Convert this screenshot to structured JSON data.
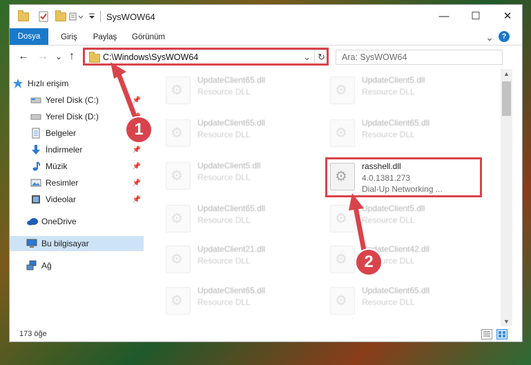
{
  "window": {
    "title": "SysWOW64",
    "minimize": "—",
    "maximize": "☐",
    "close": "✕"
  },
  "ribbon": {
    "tabs": [
      "Dosya",
      "Giriş",
      "Paylaş",
      "Görünüm"
    ],
    "expand": "⌄",
    "help": "?"
  },
  "nav": {
    "back": "←",
    "forward": "→",
    "recent": "⌄",
    "up": "↑",
    "address": "C:\\Windows\\SysWOW64",
    "address_dropdown": "⌄",
    "refresh": "↻",
    "search_placeholder": "Ara: SysWOW64"
  },
  "sidebar": {
    "items": [
      {
        "label": "Hızlı erişim",
        "icon": "star-icon"
      },
      {
        "label": "Yerel Disk (C:)",
        "icon": "drive-icon",
        "pinned": true
      },
      {
        "label": "Yerel Disk (D:)",
        "icon": "drive-icon",
        "pinned": true
      },
      {
        "label": "Belgeler",
        "icon": "documents-icon",
        "pinned": true
      },
      {
        "label": "İndirmeler",
        "icon": "download-icon",
        "pinned": true
      },
      {
        "label": "Müzik",
        "icon": "music-icon",
        "pinned": true
      },
      {
        "label": "Resimler",
        "icon": "pictures-icon",
        "pinned": true
      },
      {
        "label": "Videolar",
        "icon": "videos-icon",
        "pinned": true
      },
      {
        "label": "OneDrive",
        "icon": "cloud-icon"
      },
      {
        "label": "Bu bilgisayar",
        "icon": "computer-icon",
        "selected": true
      },
      {
        "label": "Ağ",
        "icon": "network-icon"
      }
    ],
    "pin_glyph": "📌"
  },
  "files": [
    {
      "name": "UpdateClient65.dll",
      "type": "Resource DLL"
    },
    {
      "name": "UpdateClient5.dll",
      "type": "Resource DLL"
    },
    {
      "name": "UpdateClient65.dll",
      "type": "Resource DLL"
    },
    {
      "name": "UpdateClient65.dll",
      "type": "Resource DLL"
    },
    {
      "name": "UpdateClient5.dll",
      "type": "Resource DLL"
    },
    {
      "name": "rasshell.dll",
      "version": "4.0.1381.273",
      "desc": "Dial-Up Networking ..."
    },
    {
      "name": "UpdateClient65.dll",
      "type": "Resource DLL"
    },
    {
      "name": "UpdateClient5.dll",
      "type": "Resource DLL"
    },
    {
      "name": "UpdateClient21.dll",
      "type": "Resource DLL"
    },
    {
      "name": "UpdateClient42.dll",
      "type": "Resource DLL"
    },
    {
      "name": "UpdateClient65.dll",
      "type": "Resource DLL"
    },
    {
      "name": "UpdateClient65.dll",
      "type": "Resource DLL"
    }
  ],
  "status": {
    "count": "173 öğe"
  },
  "annotations": {
    "marker1": "1",
    "marker2": "2",
    "color": "#d9434b"
  }
}
